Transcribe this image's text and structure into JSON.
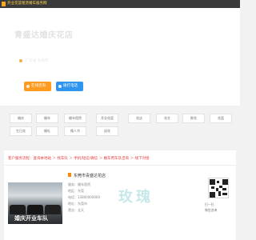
{
  "topbar": {
    "text": "开业花篮租赁婚车服务网"
  },
  "hero": {
    "title": "青盛达婚庆花店",
    "location": "广东省 东莞市",
    "btn_primary": "在线咨询",
    "btn_secondary": "拨打电话"
  },
  "tags": [
    "婚庆",
    "婚车",
    "婚车租赁",
    "开业花篮",
    "花店",
    "花艺",
    "鲜花",
    "花篮",
    "生日花",
    "婚礼",
    "情人节",
    "送花"
  ],
  "section": {
    "heading": "客户服务流程：查询本地站 ＞ 找车队 ＞ 手机/短信/微信 ＞ 婚车用车队咨询 ＞ 线下对接"
  },
  "listing": {
    "title": "东莞市青盛达花店",
    "meta": [
      "服务：婚车租赁",
      "地区：东莞",
      "电话：13800000000",
      "地址：东莞市",
      "营业：全天"
    ],
    "photo_caption": "婚庆开业车队",
    "qr_caption": "扫一扫",
    "qr_caption2": "微信咨询"
  },
  "watermark": "玫瑰"
}
